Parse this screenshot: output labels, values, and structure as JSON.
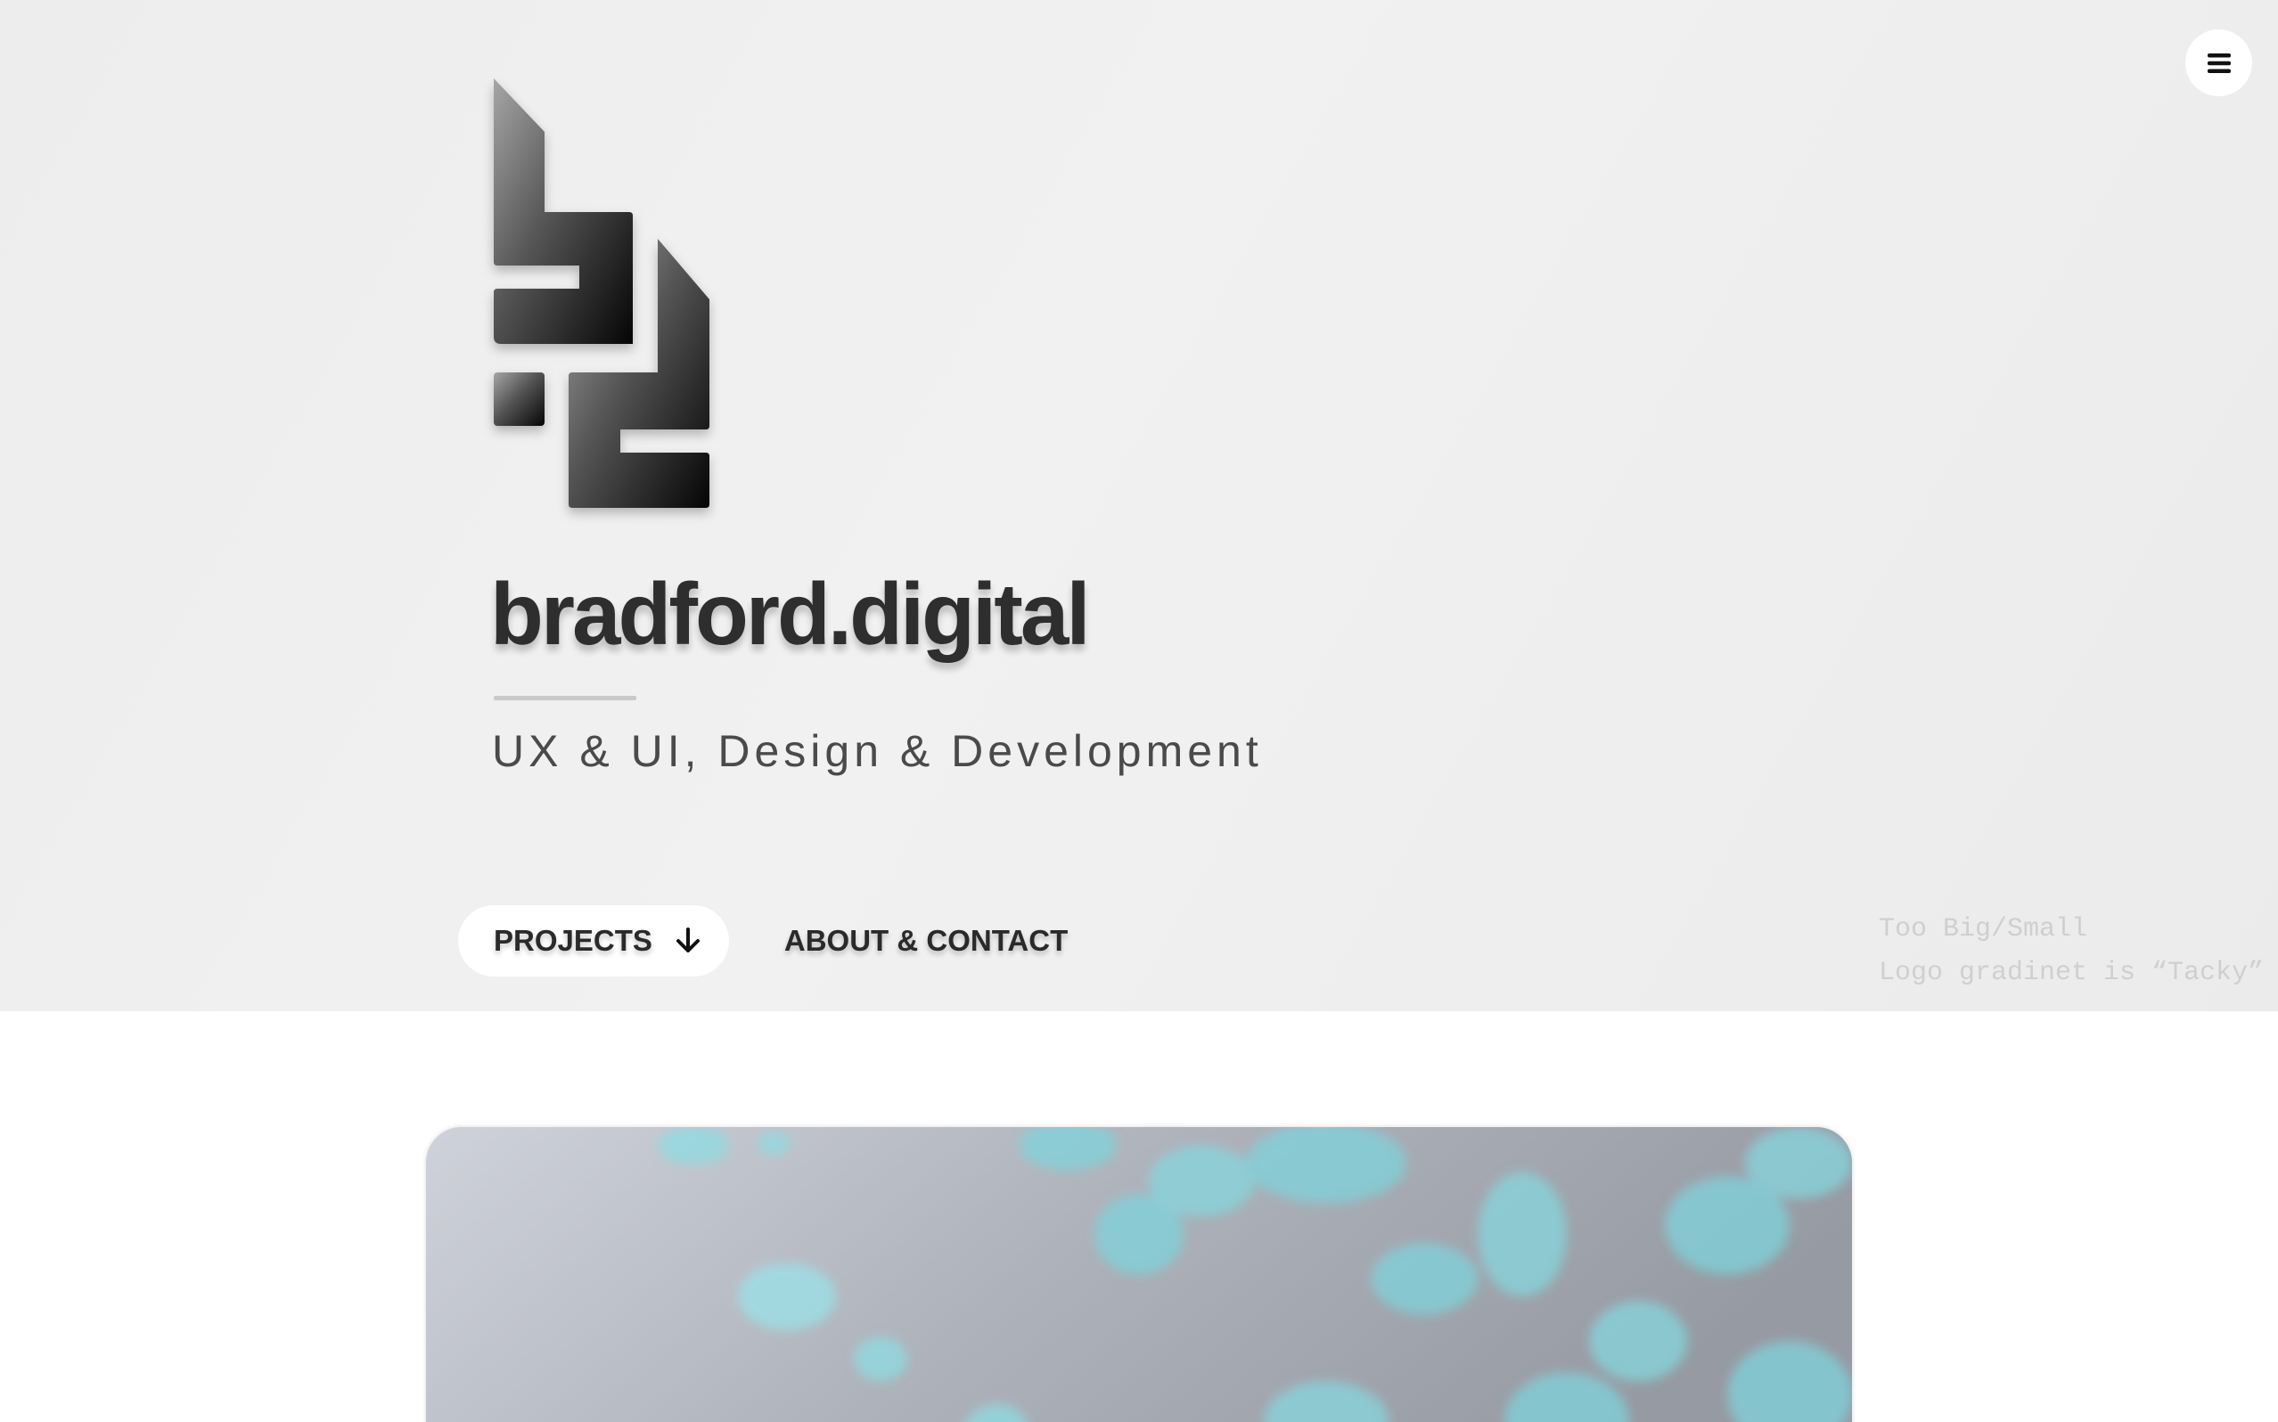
{
  "header": {
    "menu_icon": "hamburger-icon"
  },
  "brand": {
    "logo_icon": "bd-logo-icon",
    "title": "bradford.digital",
    "tagline": "UX & UI, Design & Development"
  },
  "nav": {
    "projects_label": "PROJECTS",
    "projects_icon": "arrow-down-icon",
    "about_label": "ABOUT & CONTACT"
  },
  "notes": {
    "line1": "Too Big/Small",
    "line2": "Logo gradinet is “Tacky”"
  },
  "colors": {
    "hero_background": "#eeeeee",
    "title_color": "#2e2e2e",
    "accent_teal": "#7fd3dc"
  }
}
